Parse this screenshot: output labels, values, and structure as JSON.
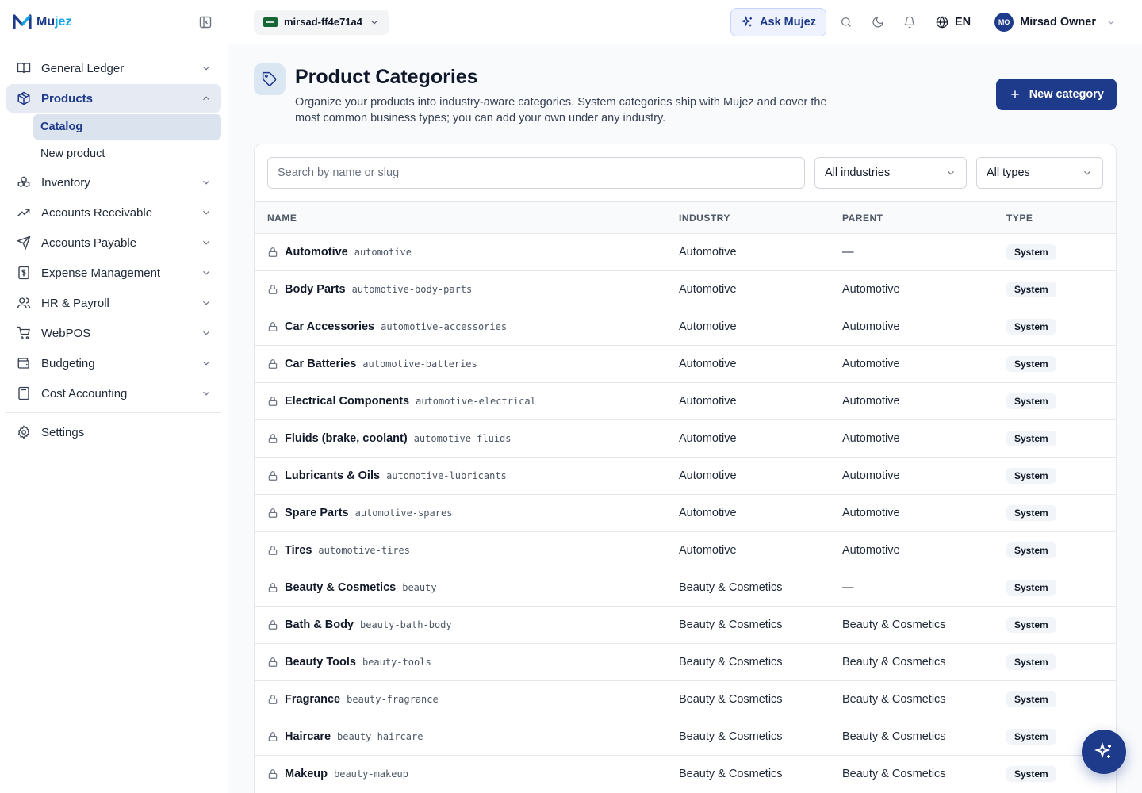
{
  "brand": {
    "name_main": "Mu",
    "name_accent": "jez"
  },
  "sidebar": {
    "items": [
      {
        "label": "General Ledger",
        "icon": "book-open-icon"
      },
      {
        "label": "Products",
        "icon": "package-icon",
        "active": true,
        "children": [
          {
            "label": "Catalog",
            "active": true
          },
          {
            "label": "New product"
          }
        ]
      },
      {
        "label": "Inventory",
        "icon": "boxes-icon"
      },
      {
        "label": "Accounts Receivable",
        "icon": "trend-up-icon"
      },
      {
        "label": "Accounts Payable",
        "icon": "send-icon"
      },
      {
        "label": "Expense Management",
        "icon": "receipt-icon"
      },
      {
        "label": "HR & Payroll",
        "icon": "users-icon"
      },
      {
        "label": "WebPOS",
        "icon": "cart-icon"
      },
      {
        "label": "Budgeting",
        "icon": "wallet-icon"
      },
      {
        "label": "Cost Accounting",
        "icon": "calculator-icon"
      }
    ],
    "settings_label": "Settings"
  },
  "topbar": {
    "org": "mirsad-ff4e71a4",
    "ask": "Ask Mujez",
    "lang": "EN",
    "user_initials": "MO",
    "user_name": "Mirsad Owner"
  },
  "page": {
    "title": "Product Categories",
    "description": "Organize your products into industry-aware categories. System categories ship with Mujez and cover the most common business types; you can add your own under any industry.",
    "new_button": "New category"
  },
  "filters": {
    "search_placeholder": "Search by name or slug",
    "industry": "All industries",
    "type": "All types"
  },
  "table": {
    "headers": {
      "name": "NAME",
      "industry": "INDUSTRY",
      "parent": "PARENT",
      "type": "TYPE"
    },
    "rows": [
      {
        "name": "Automotive",
        "slug": "automotive",
        "industry": "Automotive",
        "parent": "—",
        "type": "System"
      },
      {
        "name": "Body Parts",
        "slug": "automotive-body-parts",
        "industry": "Automotive",
        "parent": "Automotive",
        "type": "System"
      },
      {
        "name": "Car Accessories",
        "slug": "automotive-accessories",
        "industry": "Automotive",
        "parent": "Automotive",
        "type": "System"
      },
      {
        "name": "Car Batteries",
        "slug": "automotive-batteries",
        "industry": "Automotive",
        "parent": "Automotive",
        "type": "System"
      },
      {
        "name": "Electrical Components",
        "slug": "automotive-electrical",
        "industry": "Automotive",
        "parent": "Automotive",
        "type": "System"
      },
      {
        "name": "Fluids (brake, coolant)",
        "slug": "automotive-fluids",
        "industry": "Automotive",
        "parent": "Automotive",
        "type": "System"
      },
      {
        "name": "Lubricants & Oils",
        "slug": "automotive-lubricants",
        "industry": "Automotive",
        "parent": "Automotive",
        "type": "System"
      },
      {
        "name": "Spare Parts",
        "slug": "automotive-spares",
        "industry": "Automotive",
        "parent": "Automotive",
        "type": "System"
      },
      {
        "name": "Tires",
        "slug": "automotive-tires",
        "industry": "Automotive",
        "parent": "Automotive",
        "type": "System"
      },
      {
        "name": "Beauty & Cosmetics",
        "slug": "beauty",
        "industry": "Beauty & Cosmetics",
        "parent": "—",
        "type": "System"
      },
      {
        "name": "Bath & Body",
        "slug": "beauty-bath-body",
        "industry": "Beauty & Cosmetics",
        "parent": "Beauty & Cosmetics",
        "type": "System"
      },
      {
        "name": "Beauty Tools",
        "slug": "beauty-tools",
        "industry": "Beauty & Cosmetics",
        "parent": "Beauty & Cosmetics",
        "type": "System"
      },
      {
        "name": "Fragrance",
        "slug": "beauty-fragrance",
        "industry": "Beauty & Cosmetics",
        "parent": "Beauty & Cosmetics",
        "type": "System"
      },
      {
        "name": "Haircare",
        "slug": "beauty-haircare",
        "industry": "Beauty & Cosmetics",
        "parent": "Beauty & Cosmetics",
        "type": "System"
      },
      {
        "name": "Makeup",
        "slug": "beauty-makeup",
        "industry": "Beauty & Cosmetics",
        "parent": "Beauty & Cosmetics",
        "type": "System"
      }
    ]
  },
  "colors": {
    "primary": "#1e3a8a",
    "accent": "#0ea5e9"
  }
}
